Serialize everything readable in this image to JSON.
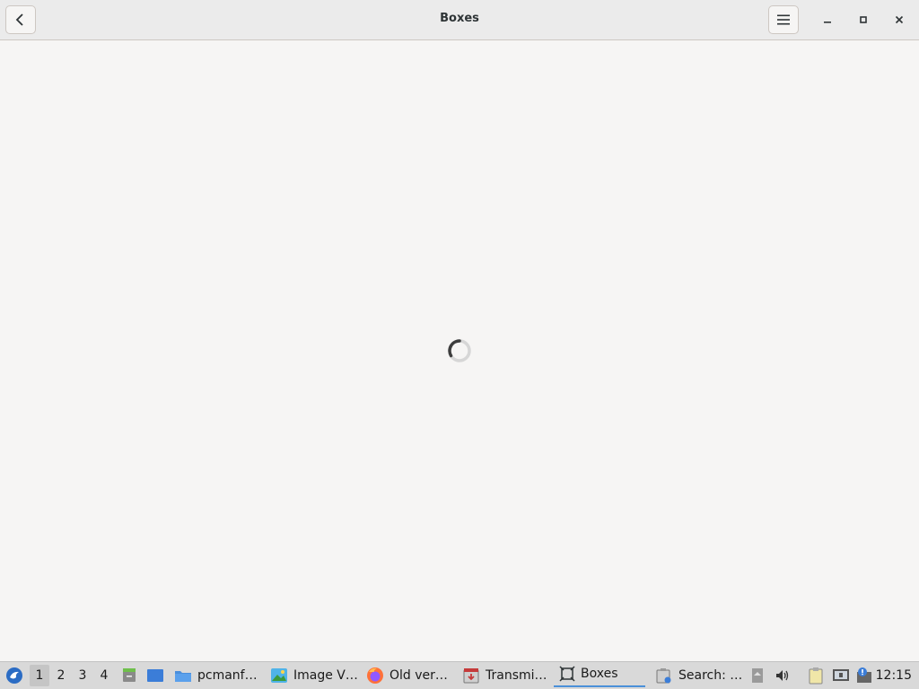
{
  "window": {
    "title": "Boxes"
  },
  "taskbar": {
    "workspaces": [
      "1",
      "2",
      "3",
      "4"
    ],
    "active_workspace": "1",
    "tasks": [
      {
        "label": "pcmanf…",
        "icon": "folder-icon"
      },
      {
        "label": "Image V…",
        "icon": "image-viewer-icon"
      },
      {
        "label": "Old ver…",
        "icon": "firefox-icon"
      },
      {
        "label": "Transmi…",
        "icon": "transmission-icon"
      },
      {
        "label": "Boxes",
        "icon": "boxes-icon",
        "active": true
      },
      {
        "label": "Search: …",
        "icon": "search-files-icon"
      }
    ],
    "clock": "12:15"
  },
  "colors": {
    "accent": "#4a90d9",
    "headerbar": "#ebebeb",
    "background": "#f6f5f4",
    "taskbar": "#d9d9d9"
  }
}
